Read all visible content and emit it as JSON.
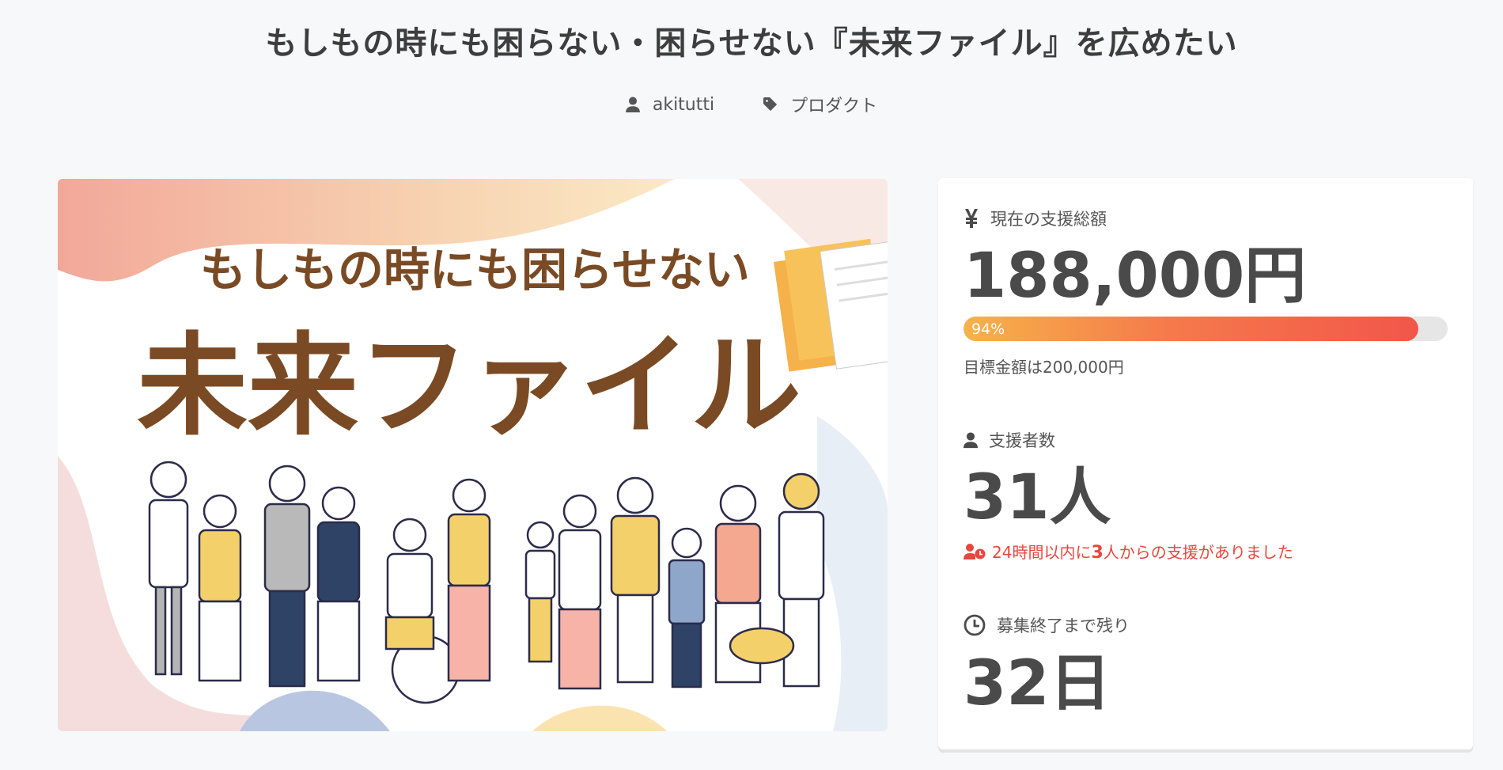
{
  "page": {
    "title": "もしもの時にも困らない・困らせない『未来ファイル』を広めたい"
  },
  "meta": {
    "author": "akitutti",
    "category": "プロダクト"
  },
  "hero": {
    "headline_small": "もしもの時にも困らせない",
    "headline_large": "未来ファイル"
  },
  "stats": {
    "total": {
      "icon": "yen-icon",
      "label": "現在の支援総額",
      "amount": "188,000円",
      "progress_percent": 94,
      "progress_text": "94%",
      "goal_text": "目標金額は200,000円"
    },
    "supporters": {
      "icon": "user-icon",
      "label": "支援者数",
      "count": "31人",
      "recent_pre": "24時間以内に",
      "recent_num": "3",
      "recent_post": "人からの支援がありました"
    },
    "remaining": {
      "icon": "clock-icon",
      "label": "募集終了まで残り",
      "days": "32日"
    }
  },
  "colors": {
    "accent_red": "#e8473e",
    "progress_start": "#f6b24a",
    "progress_end": "#f2564a",
    "hero_brown": "#7a4a24"
  }
}
